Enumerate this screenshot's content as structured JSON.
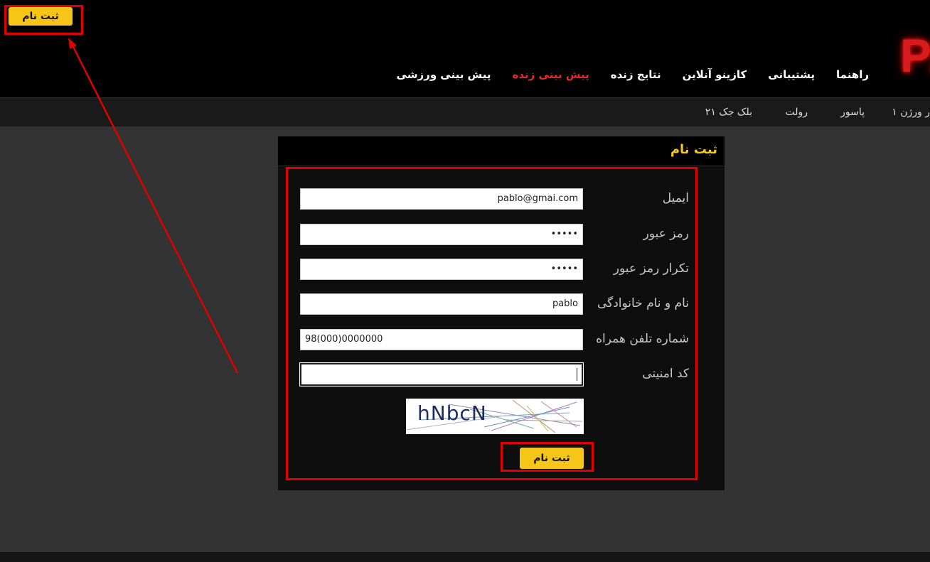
{
  "header": {
    "register_button_label": "ثبت نام",
    "logo_text": "PA",
    "nav_items": [
      {
        "label": "پیش بینی ورزشی",
        "active": false
      },
      {
        "label": "پیش بینی زنده",
        "active": true
      },
      {
        "label": "نتایج زنده",
        "active": false
      },
      {
        "label": "کازینو آنلاین",
        "active": false
      },
      {
        "label": "پشتیبانی",
        "active": false
      },
      {
        "label": "راهنما",
        "active": false
      }
    ]
  },
  "subnav": {
    "items": [
      "ر ورژن ۱",
      "پاسور",
      "رولت",
      "بلک جک ۲۱"
    ]
  },
  "form": {
    "title": "ثبت نام",
    "email_label": "ایمیل",
    "email_value": "pablo@gmai.com",
    "password_label": "رمز عبور",
    "password_value": "•••••",
    "password_confirm_label": "تکرار رمز عبور",
    "password_confirm_value": "•••••",
    "fullname_label": "نام و نام خانوادگی",
    "fullname_value": "pablo",
    "phone_label": "شماره تلفن همراه",
    "phone_value": "98(000)0000000",
    "security_code_label": "کد امنیتی",
    "security_code_value": "",
    "captcha_text": "hNbcN",
    "submit_label": "ثبت نام"
  },
  "colors": {
    "accent_yellow": "#f5c518",
    "active_nav_red": "#e82a2a",
    "annotation_red": "#e00000"
  }
}
